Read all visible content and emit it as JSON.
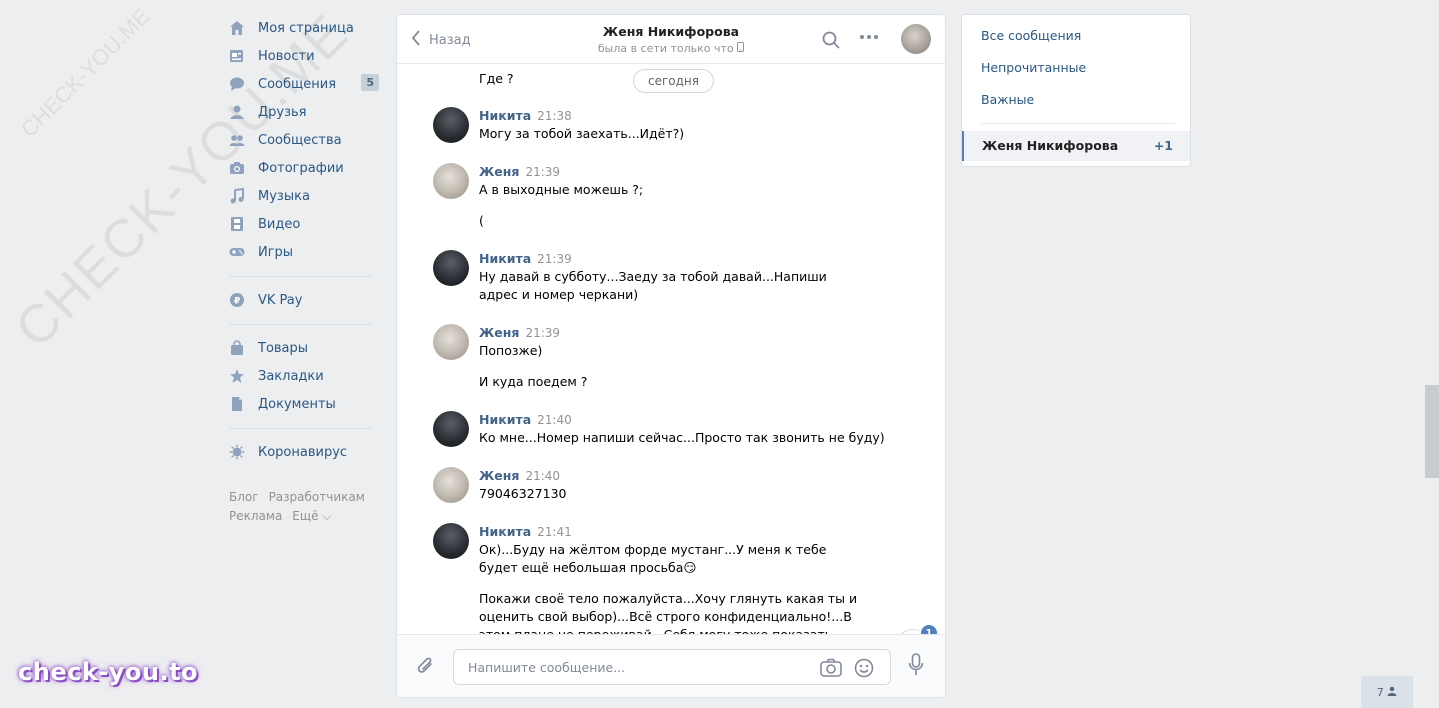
{
  "watermark": {
    "big": "CHECK-YOU.ME",
    "small": "CHECK-YOU.ME",
    "badge": "check-you.to"
  },
  "nav": {
    "items": [
      {
        "label": "Моя страница",
        "icon": "home-icon"
      },
      {
        "label": "Новости",
        "icon": "news-icon"
      },
      {
        "label": "Сообщения",
        "icon": "messages-icon",
        "counter": "5"
      },
      {
        "label": "Друзья",
        "icon": "friends-icon"
      },
      {
        "label": "Сообщества",
        "icon": "communities-icon"
      },
      {
        "label": "Фотографии",
        "icon": "camera-icon"
      },
      {
        "label": "Музыка",
        "icon": "music-note-icon"
      },
      {
        "label": "Видео",
        "icon": "film-icon"
      },
      {
        "label": "Игры",
        "icon": "gamepad-icon"
      }
    ],
    "vkpay": "VK Pay",
    "group2": [
      {
        "label": "Товары",
        "icon": "bag-icon"
      },
      {
        "label": "Закладки",
        "icon": "star-icon"
      },
      {
        "label": "Документы",
        "icon": "document-icon"
      }
    ],
    "corona": "Коронавирус",
    "footer": {
      "blog": "Блог",
      "dev": "Разработчикам",
      "ads": "Реклама",
      "more": "Ещё ⌵"
    }
  },
  "chat": {
    "back_label": "Назад",
    "peer_name": "Женя Никифорова",
    "peer_status": "была в сети только что",
    "first_line": "Где ?",
    "date_pill": "сегодня",
    "messages": [
      {
        "author": "Никита",
        "time": "21:38",
        "lines": [
          "Могу за тобой заехать...Идёт?)"
        ]
      },
      {
        "author": "Женя",
        "time": "21:39",
        "lines": [
          "А в выходные можешь ?;",
          "("
        ]
      },
      {
        "author": "Никита",
        "time": "21:39",
        "lines": [
          "Ну давай в субботу...Заеду за тобой давай...Напиши адрес и номер черкани)"
        ]
      },
      {
        "author": "Женя",
        "time": "21:39",
        "lines": [
          "Попозже)",
          "И куда поедем ?"
        ]
      },
      {
        "author": "Никита",
        "time": "21:40",
        "lines": [
          "Ко мне...Номер напиши сейчас...Просто так звонить не буду)"
        ]
      },
      {
        "author": "Женя",
        "time": "21:40",
        "lines": [
          "79046327130"
        ]
      },
      {
        "author": "Никита",
        "time": "21:41",
        "lines": [
          "Ок)...Буду на жёлтом форде мустанг...У меня к тебе будет ещё небольшая просьба😏",
          "Покажи своё тело пожалуйста...Хочу глянуть какая ты и оценить свой выбор)...Всё строго конфиденциально!...В этом плане не переживай...Себя могу тоже показать чтоб и для"
        ]
      }
    ],
    "unread_badge": "1",
    "composer_placeholder": "Напишите сообщение..."
  },
  "filters": {
    "all": "Все сообщения",
    "unread": "Непрочитанные",
    "important": "Важные",
    "active_name": "Женя Никифорова",
    "active_count": "+1"
  },
  "online_count": "7"
}
